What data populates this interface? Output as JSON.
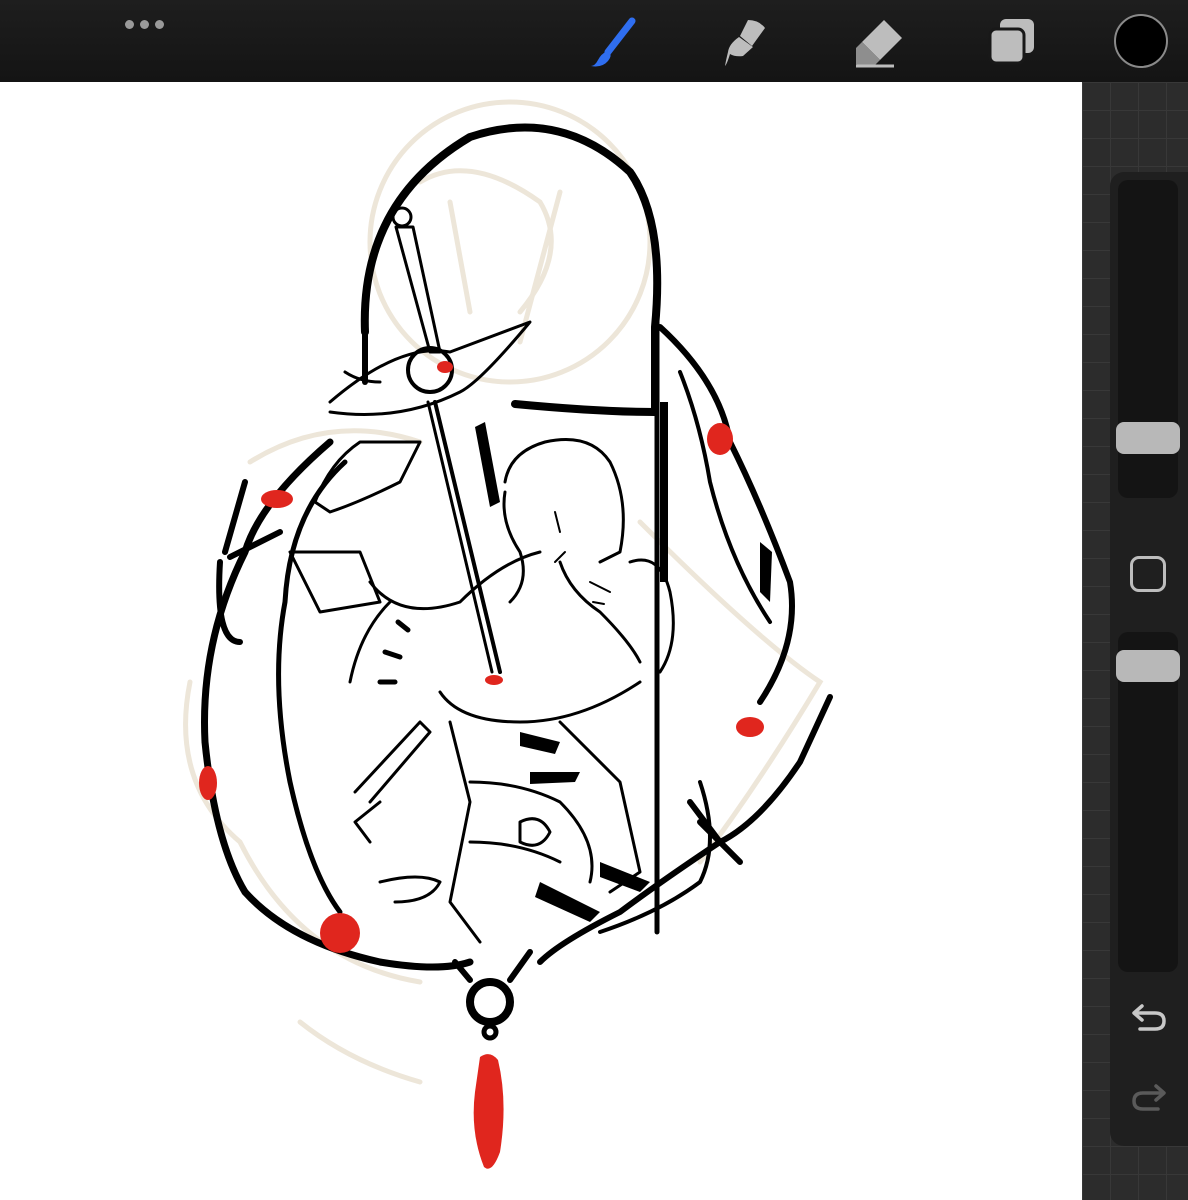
{
  "toolbar": {
    "more_icon": "ellipsis-icon",
    "tools": [
      {
        "name": "brush",
        "icon": "brush-icon",
        "active": true,
        "color": "#2f6ef0"
      },
      {
        "name": "smudge",
        "icon": "smudge-icon",
        "active": false,
        "color": "#bdbdbd"
      },
      {
        "name": "eraser",
        "icon": "eraser-icon",
        "active": false,
        "color": "#bdbdbd"
      },
      {
        "name": "layers",
        "icon": "layers-icon",
        "active": false,
        "color": "#bdbdbd"
      }
    ],
    "current_color": "#000000"
  },
  "sidebar": {
    "brush_size_icon": "slider-thumb",
    "modify_icon": "square-icon",
    "opacity_icon": "slider-thumb",
    "undo_icon": "undo-icon",
    "redo_icon": "redo-icon"
  },
  "artwork": {
    "style": "black line-art with red accents",
    "accent_color": "#e0261e",
    "line_color": "#000000",
    "sketch_color": "#ede6d9"
  }
}
